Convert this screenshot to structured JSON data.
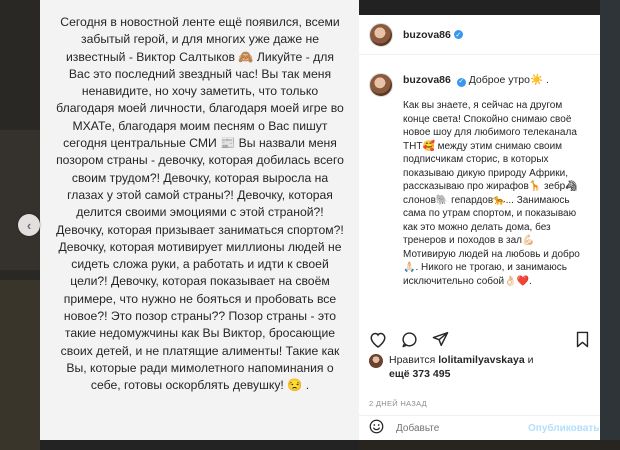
{
  "media": {
    "text_blurred_top": "",
    "text": "Сегодня в новостной ленте ещё появился, всеми забытый герой, и для многих уже даже не известный - Виктор Салтыков 🙈 Ликуйте - для Вас это последний звездный час! Вы так меня ненавидите, но хочу заметить, что только благодаря моей личности, благодаря моей игре во МХАТе, благодаря моим песням о Вас пишут сегодня центральные СМИ 📰 Вы назвали меня позором страны - девочку, которая добилась всего своим трудом?! Девочку, которая выросла на глазах у этой самой страны?! Девочку, которая делится своими эмоциями с этой страной?! Девочку, которая призывает заниматься спортом?! Девочку, которая мотивирует миллионы людей не сидеть сложа руки, а работать и идти к своей цели?! Девочку, которая показывает на своём примере, что нужно не бояться и пробовать все новое?! Это позор страны?? Позор страны - это такие недомужчины как Вы Виктор, бросающие своих детей, и не платящие алименты! Такие как Вы, которые ради мимолетного напоминания о себе, готовы оскорблять девушку! 😒 ."
  },
  "nav": {
    "prev_icon": "chevron-left-icon"
  },
  "post": {
    "username": "buzova86",
    "caption_greeting": "Доброе утро☀️ .",
    "caption_body": "Как вы знаете, я сейчас на другом конце света! Спокойно снимаю своё новое шоу для любимого телеканала ТНТ🥰 между этим снимаю своим подписчикам сторис, в которых показываю дикую природу Африки, рассказываю про жирафов🦒 зебр🦓 слонов🐘 гепардов🐆... Занимаюсь сама по утрам спортом, и показываю как это можно делать дома, без тренеров и походов в зал💪🏻 Мотивирую людей на любовь и добро🙏🏻. Никого не трогаю, и занимаюсь исключительно собой👌🏻❤️.",
    "liked_by_prefix": "Нравится",
    "liked_by_user": "lolitamilyavskaya",
    "liked_and": "и",
    "likes_count": "ещё 373 495",
    "date": "2 ДНЕЙ НАЗАД",
    "comment_placeholder": "Добавьте",
    "publish_label": "Опубликовать"
  },
  "colors": {
    "verified": "#3897f0",
    "publish_disabled": "#b2dffc",
    "meta_gray": "#8e8e8e"
  }
}
